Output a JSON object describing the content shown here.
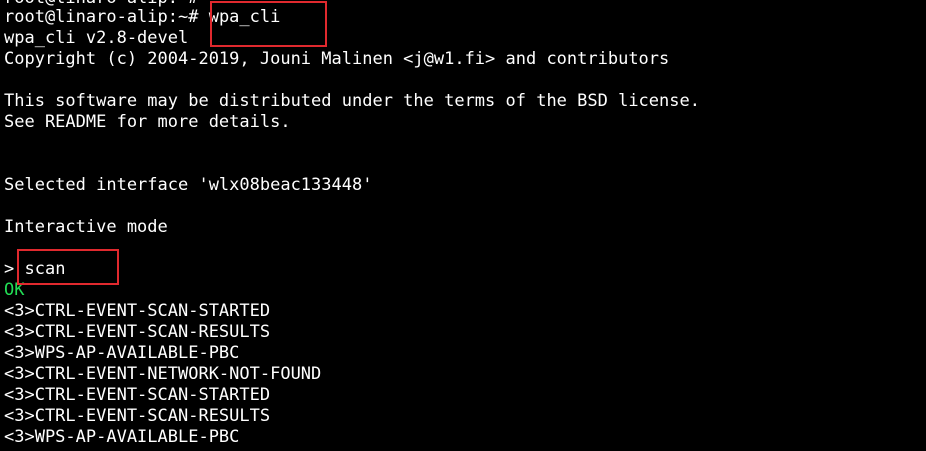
{
  "colors": {
    "background": "#000000",
    "text": "#ffffff",
    "ok": "#22dd55",
    "annotation_box": "#e0292e"
  },
  "terminal": {
    "lines": {
      "partial_top": "root@linaro-alip:~#",
      "prompt": "root@linaro-alip:~#",
      "command": " wpa_cli",
      "version": "wpa_cli v2.8-devel",
      "copyright": "Copyright (c) 2004-2019, Jouni Malinen <j@w1.fi> and contributors",
      "license_1": "This software may be distributed under the terms of the BSD license.",
      "license_2": "See README for more details.",
      "selected_interface": "Selected interface 'wlx08beac133448'",
      "interactive_mode": "Interactive mode",
      "scan_prompt": ">",
      "scan_command": " scan",
      "ok": "OK",
      "events": [
        "<3>CTRL-EVENT-SCAN-STARTED",
        "<3>CTRL-EVENT-SCAN-RESULTS",
        "<3>WPS-AP-AVAILABLE-PBC",
        "<3>CTRL-EVENT-NETWORK-NOT-FOUND",
        "<3>CTRL-EVENT-SCAN-STARTED",
        "<3>CTRL-EVENT-SCAN-RESULTS",
        "<3>WPS-AP-AVAILABLE-PBC"
      ]
    }
  }
}
